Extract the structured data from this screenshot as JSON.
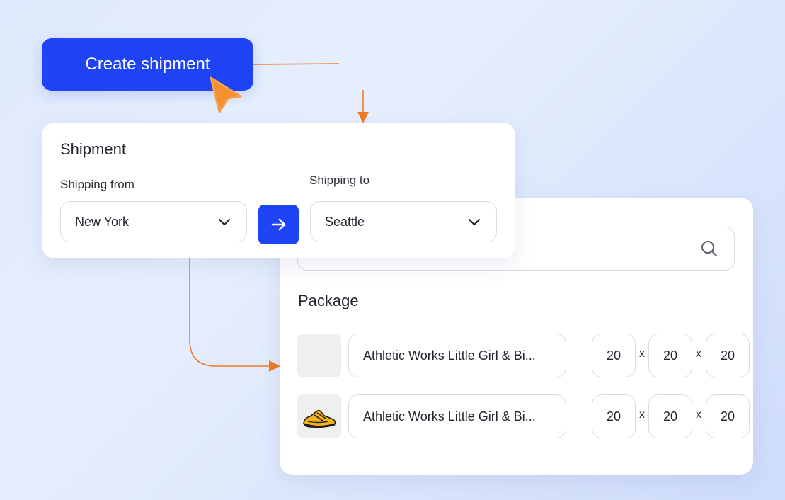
{
  "create_button": {
    "label": "Create shipment"
  },
  "shipment": {
    "title": "Shipment",
    "from_label": "Shipping from",
    "from_value": "New York",
    "to_label": "Shipping to",
    "to_value": "Seattle"
  },
  "search": {
    "placeholder": ""
  },
  "package": {
    "title": "Package",
    "dimension_separator": "x",
    "items": [
      {
        "name": "Athletic Works Little Girl & Bi...",
        "thumbnail": "empty",
        "length": "20",
        "width": "20",
        "height": "20"
      },
      {
        "name": "Athletic Works Little Girl & Bi...",
        "thumbnail": "sneaker-image",
        "length": "20",
        "width": "20",
        "height": "20"
      }
    ]
  },
  "colors": {
    "accent": "#1f44f5",
    "connector": "#f07a25",
    "cursor": "#f7902f"
  },
  "icons": [
    "cursor-arrow-icon",
    "chevron-down-icon",
    "arrow-right-icon",
    "search-icon",
    "sneaker-image"
  ]
}
